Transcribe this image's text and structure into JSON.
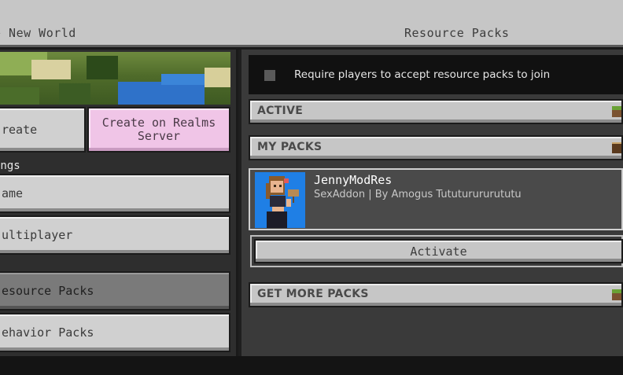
{
  "header": {
    "left_title": "e New World",
    "right_title": "Resource Packs"
  },
  "left": {
    "create_label": "reate",
    "realms_label": "Create on Realms Server",
    "settings_label": "ings",
    "menu": [
      {
        "label": "ame"
      },
      {
        "label": "ultiplayer"
      },
      {
        "label": "esource Packs",
        "selected": true
      },
      {
        "label": "ehavior Packs"
      }
    ]
  },
  "right": {
    "require_checkbox": {
      "label": "Require players to accept resource packs to join",
      "checked": false
    },
    "sections": {
      "active": "ACTIVE",
      "my_packs": "MY PACKS",
      "get_more": "GET MORE PACKS"
    },
    "pack": {
      "name": "JennyModRes",
      "meta": "SexAddon | By Amogus Tututurururututu"
    },
    "activate_label": "Activate"
  },
  "colors": {
    "pink_button": "#f0c5e7",
    "panel_bg": "#3a3a3a",
    "pack_thumb_bg": "#1f7fe5"
  },
  "icons": {
    "active": "grass-block-icon",
    "my_packs": "book-icon",
    "get_more": "grass-block-icon"
  }
}
